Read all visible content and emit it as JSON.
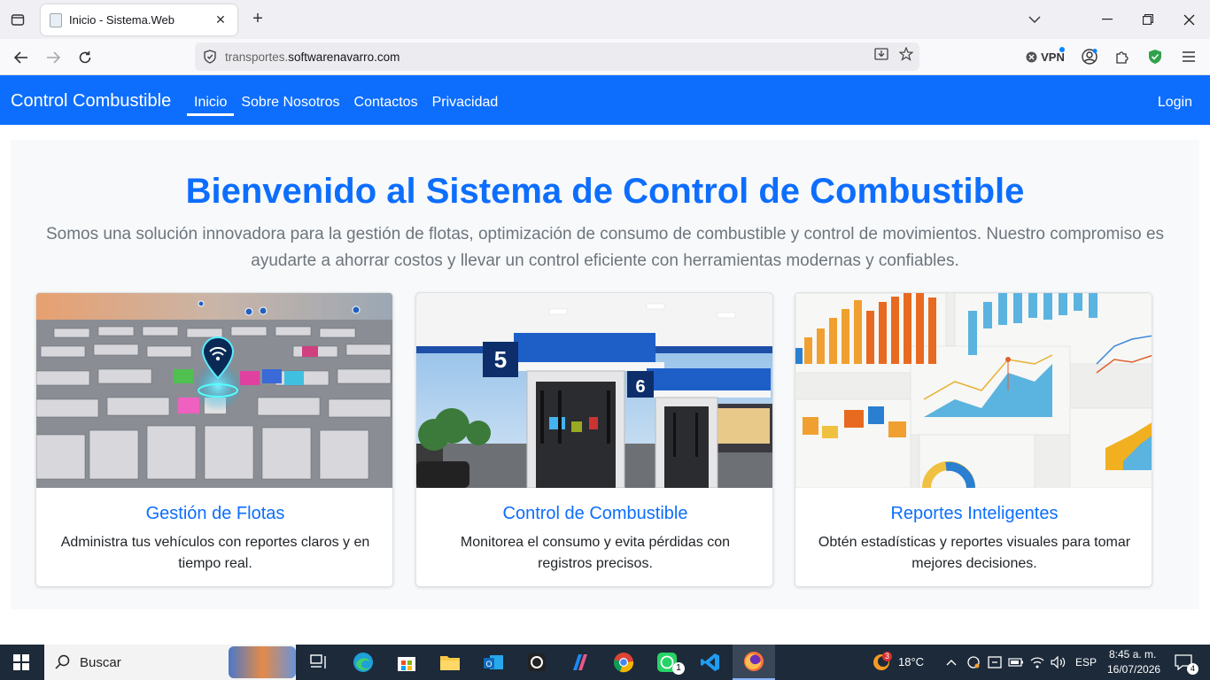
{
  "browser": {
    "tab_title": "Inicio - Sistema.Web",
    "url_subdomain": "transportes.",
    "url_domain": "softwarenavarro.com",
    "vpn_label": "VPN"
  },
  "navbar": {
    "brand": "Control Combustible",
    "links": [
      {
        "label": "Inicio"
      },
      {
        "label": "Sobre Nosotros"
      },
      {
        "label": "Contactos"
      },
      {
        "label": "Privacidad"
      }
    ],
    "login": "Login"
  },
  "hero": {
    "title": "Bienvenido al Sistema de Control de Combustible",
    "lead": "Somos una solución innovadora para la gestión de flotas, optimización de consumo de combustible y control de movimientos. Nuestro compromiso es ayudarte a ahorrar costos y llevar un control eficiente con herramientas modernas y confiables."
  },
  "cards": [
    {
      "title": "Gestión de Flotas",
      "text": "Administra tus vehículos con reportes claros y en tiempo real.",
      "image": "fleet-trucks-image"
    },
    {
      "title": "Control de Combustible",
      "text": "Monitorea el consumo y evita pérdidas con registros precisos.",
      "image": "gas-station-image"
    },
    {
      "title": "Reportes Inteligentes",
      "text": "Obtén estadísticas y reportes visuales para tomar mejores decisiones.",
      "image": "charts-report-image"
    }
  ],
  "gas_station": {
    "pump_5": "5",
    "pump_6": "6"
  },
  "taskbar": {
    "search_label": "Buscar",
    "weather": "18°C",
    "weather_badge": "3",
    "language": "ESP",
    "time": "8:45 a. m.",
    "date": "16/07/2026",
    "notifications": "4",
    "whatsapp_badge": "1"
  },
  "colors": {
    "primary": "#0d6efd",
    "navbar": "#0d6efd",
    "hero_bg": "#f8f9fa",
    "taskbar": "#1c2a3a"
  }
}
